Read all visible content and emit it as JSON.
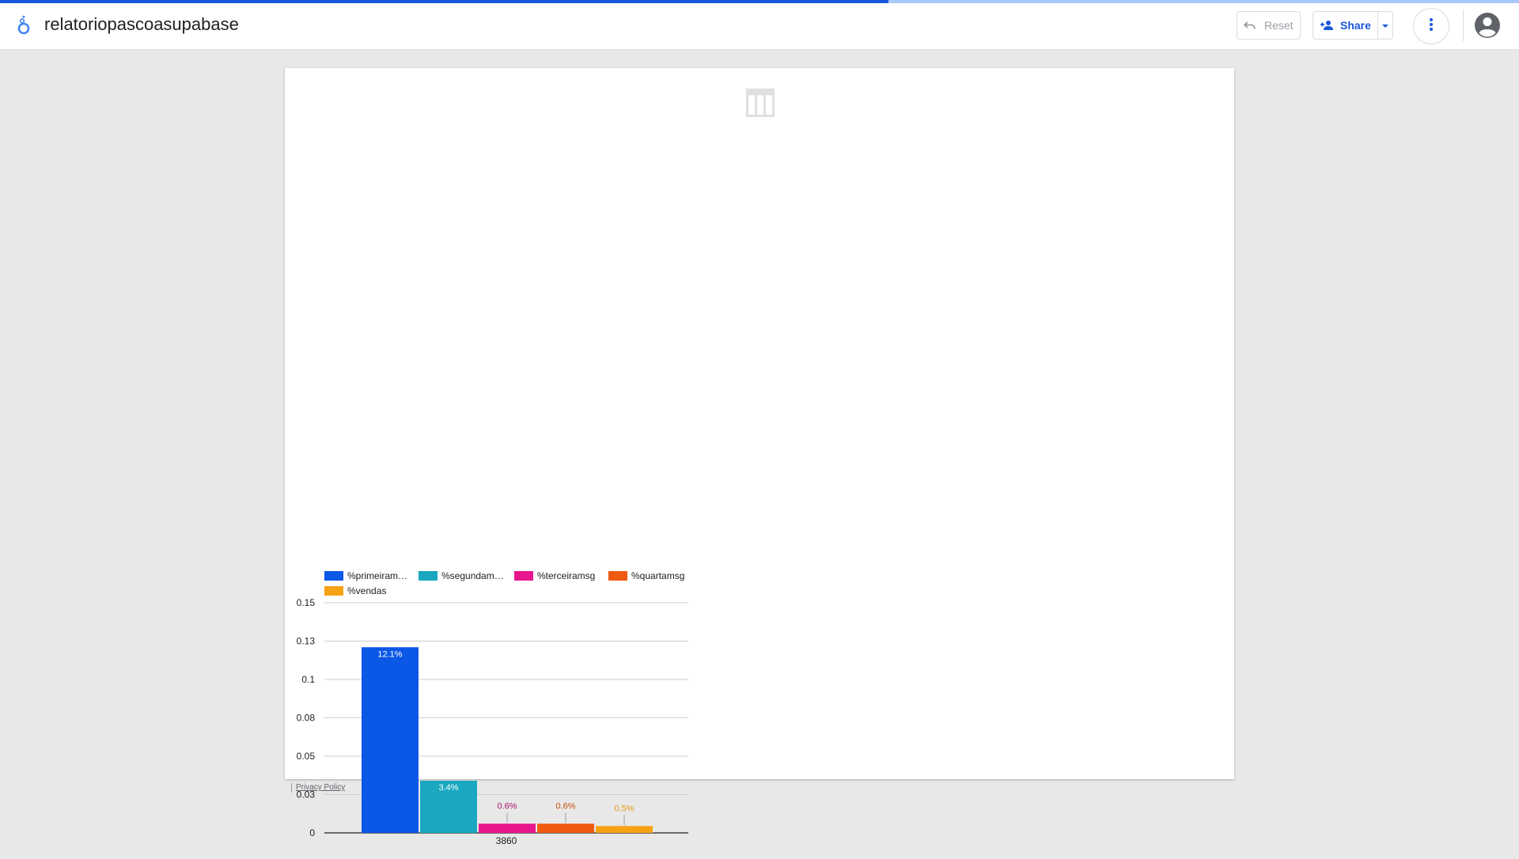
{
  "header": {
    "report_title": "relatoriopascoasupabase",
    "reset_label": "Reset",
    "share_label": "Share",
    "load_progress": 0.585
  },
  "footer": {
    "privacy_label": "Privacy Policy"
  },
  "colors": {
    "brand_blue": "#1a56db",
    "primeira": "#0b57e6",
    "segunda": "#19a8bf",
    "terceira": "#e8168c",
    "quarta": "#ee5a12",
    "vendas": "#f5a215"
  },
  "chart_data": {
    "type": "bar",
    "categories": [
      "3860"
    ],
    "series": [
      {
        "name": "%primeiram…",
        "values": [
          0.121
        ],
        "label": "12.1%",
        "color": "#0b57e6",
        "label_color": "#ffffff"
      },
      {
        "name": "%segundam…",
        "values": [
          0.034
        ],
        "label": "3.4%",
        "color": "#19a8bf",
        "label_color": "#ffffff"
      },
      {
        "name": "%terceiramsg",
        "values": [
          0.006
        ],
        "label": "0.6%",
        "color": "#e8168c",
        "label_color": "#a8126c"
      },
      {
        "name": "%quartamsg",
        "values": [
          0.006
        ],
        "label": "0.6%",
        "color": "#ee5a12",
        "label_color": "#c9500f"
      },
      {
        "name": "%vendas",
        "values": [
          0.0045
        ],
        "label": "0.5%",
        "color": "#f5a215",
        "label_color": "#e09a16"
      }
    ],
    "yticks": [
      "0",
      "0.03",
      "0.05",
      "0.08",
      "0.1",
      "0.13",
      "0.15"
    ],
    "ylim": [
      0,
      0.15
    ],
    "grid": true,
    "legend_position": "top"
  }
}
